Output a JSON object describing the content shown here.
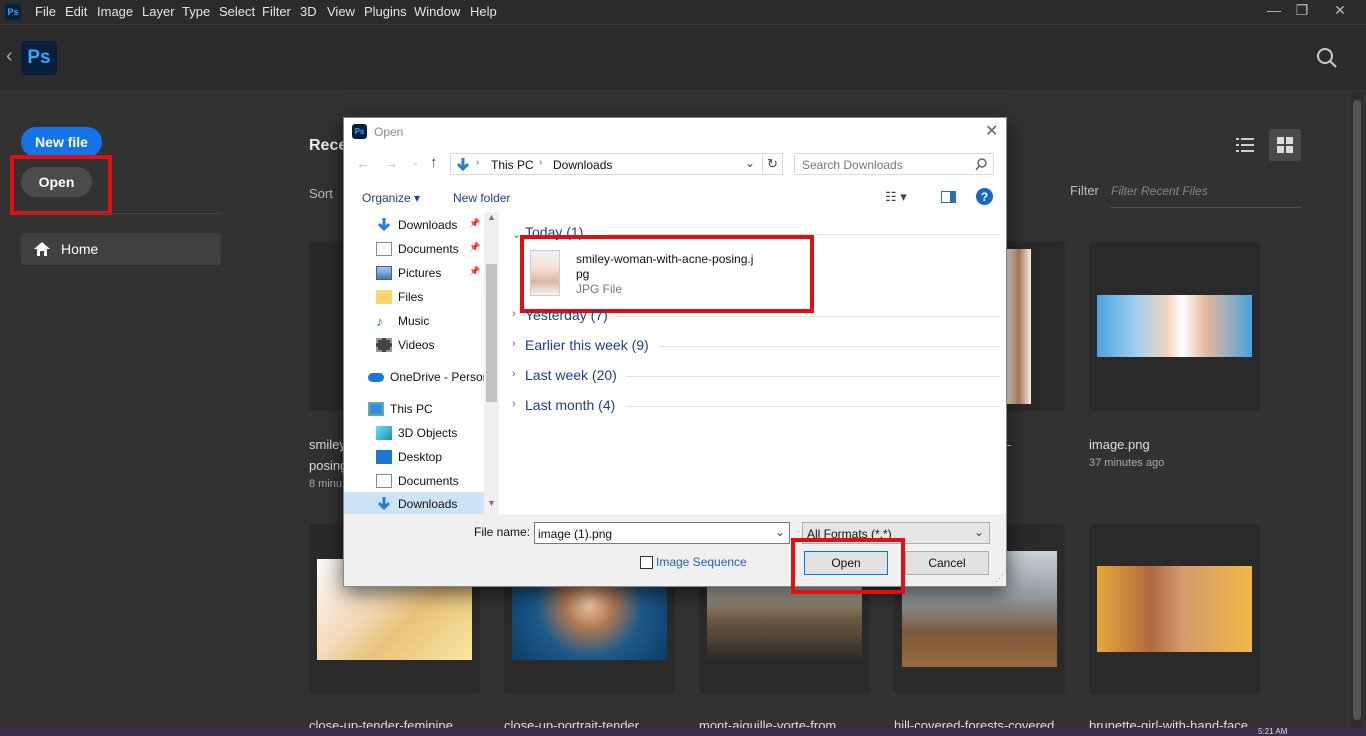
{
  "menubar": {
    "items": [
      "File",
      "Edit",
      "Image",
      "Layer",
      "Type",
      "Select",
      "Filter",
      "3D",
      "View",
      "Plugins",
      "Window",
      "Help"
    ],
    "minimize": "—",
    "restore": "❐",
    "close": "✕"
  },
  "app": {
    "logo": "Ps",
    "back": "‹"
  },
  "sidebar": {
    "new_file": "New file",
    "open": "Open",
    "home": "Home"
  },
  "main": {
    "recent_heading": "Rece",
    "sort_label": "Sort",
    "filter_label": "Filter",
    "filter_placeholder": "Filter Recent Files",
    "cards_row1": [
      {
        "name_line1": "smiley",
        "name_line2": "posing",
        "time": "8 minu"
      },
      {
        "name_line1": "-",
        "name_line2": "",
        "time": ""
      },
      {
        "name_line1": "image.png",
        "name_line2": "",
        "time": "37 minutes ago"
      }
    ],
    "cards_row2": [
      {
        "name": "close-up-tender-feminine"
      },
      {
        "name": "close-up-portrait-tender"
      },
      {
        "name": "mont-aiguille-vorte-from"
      },
      {
        "name": "hill-covered-forests-covered"
      },
      {
        "name": "brunette-girl-with-hand-face"
      }
    ]
  },
  "dialog": {
    "title": "Open",
    "breadcrumb": [
      "This PC",
      "Downloads"
    ],
    "search_placeholder": "Search Downloads",
    "organize": "Organize",
    "new_folder": "New folder",
    "nav_items": [
      {
        "label": "Downloads",
        "icon": "download-icon",
        "pinned": true
      },
      {
        "label": "Documents",
        "icon": "document-icon",
        "pinned": true
      },
      {
        "label": "Pictures",
        "icon": "pictures-icon",
        "pinned": true
      },
      {
        "label": "Files",
        "icon": "folder-icon",
        "pinned": false
      },
      {
        "label": "Music",
        "icon": "music-icon",
        "pinned": false
      },
      {
        "label": "Videos",
        "icon": "videos-icon",
        "pinned": false
      },
      {
        "label": "OneDrive - Persor",
        "icon": "onedrive-icon",
        "pinned": false
      },
      {
        "label": "This PC",
        "icon": "pc-icon",
        "pinned": false
      },
      {
        "label": "3D Objects",
        "icon": "3d-objects-icon",
        "pinned": false
      },
      {
        "label": "Desktop",
        "icon": "desktop-icon",
        "pinned": false
      },
      {
        "label": "Documents",
        "icon": "document-icon",
        "pinned": false
      },
      {
        "label": "Downloads",
        "icon": "download-icon",
        "pinned": false
      }
    ],
    "groups": [
      {
        "label": "Today (1)"
      },
      {
        "label": "Yesterday (7)"
      },
      {
        "label": "Earlier this week (9)"
      },
      {
        "label": "Last week (20)"
      },
      {
        "label": "Last month (4)"
      }
    ],
    "file": {
      "name_line1": "smiley-woman-with-acne-posing.j",
      "name_line2": "pg",
      "type": "JPG File"
    },
    "file_name_label": "File name:",
    "file_name_value": "image (1).png",
    "format": "All Formats (*.*)",
    "image_sequence": "Image Sequence",
    "open_button": "Open",
    "cancel_button": "Cancel"
  },
  "taskbar": {
    "time": "5:21 AM"
  }
}
